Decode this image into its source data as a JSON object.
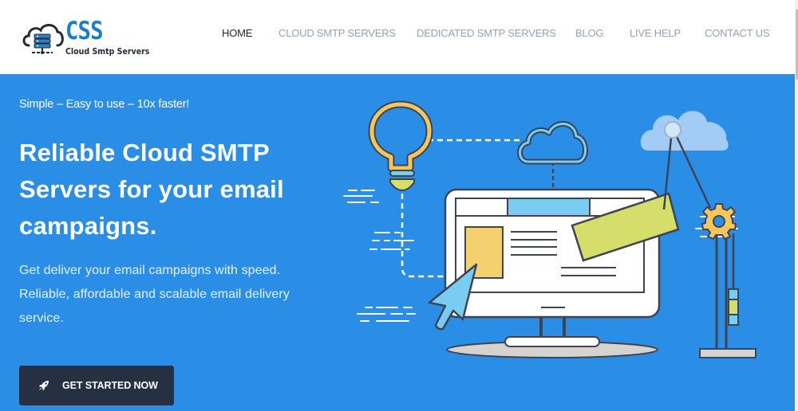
{
  "brand": {
    "logo_text": "CSS",
    "logo_subtitle": "Cloud Smtp Servers",
    "logo_icon": "cloud-server-icon",
    "primary_color": "#1a7fc9"
  },
  "nav": {
    "items": [
      {
        "label": "HOME",
        "active": true
      },
      {
        "label": "CLOUD SMTP SERVERS",
        "active": false
      },
      {
        "label": "DEDICATED SMTP SERVERS",
        "active": false
      },
      {
        "label": "BLOG",
        "active": false
      },
      {
        "label": "LIVE HELP",
        "active": false
      },
      {
        "label": "CONTACT US",
        "active": false
      }
    ]
  },
  "hero": {
    "background_color": "#2a8ee6",
    "tagline": "Simple – Easy to use – 10x faster!",
    "headline_lines": [
      "Reliable Cloud SMTP",
      "Servers for your email",
      "campaigns."
    ],
    "description_lines": [
      "Get deliver your email campaigns with speed.",
      "Reliable, affordable and scalable email delivery",
      "service."
    ],
    "cta": {
      "label": "GET STARTED NOW",
      "icon": "rocket-icon",
      "background_color": "#253142"
    },
    "illustration": {
      "description": "Monitor with webpage layout, lightbulb, clouds, cursor arrow, gear on stand",
      "icons": [
        "lightbulb-icon",
        "cloud-icon",
        "monitor-icon",
        "cursor-icon",
        "gear-icon",
        "cloud-solid-icon"
      ]
    }
  }
}
